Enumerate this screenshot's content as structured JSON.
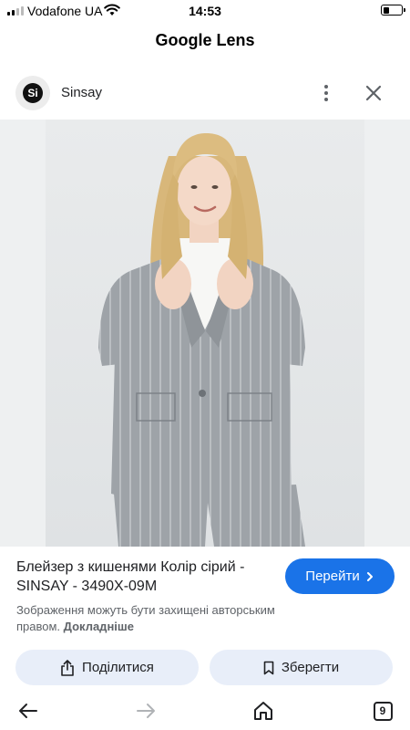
{
  "status_bar": {
    "carrier": "Vodafone UA",
    "time": "14:53",
    "battery_level": 0.3,
    "signal_bars": 2
  },
  "app": {
    "title": "Google Lens"
  },
  "source": {
    "logo_text": "Si",
    "name": "Sinsay",
    "icons": {
      "more": "more-vert-icon",
      "close": "close-icon"
    }
  },
  "result": {
    "title": "Блейзер з кишенями Колір сірий - SINSAY - 3490X-09M",
    "go_label": "Перейти",
    "copyright_text": "Зображення можуть бути захищені авторським правом.",
    "learn_more": "Докладніше"
  },
  "actions": {
    "share_label": "Поділитися",
    "save_label": "Зберегти"
  },
  "bottom_nav": {
    "tabs_count": "9"
  },
  "colors": {
    "accent": "#1a73e8",
    "pill_bg": "#e8eef9",
    "blazer": "#9ea3a8"
  }
}
